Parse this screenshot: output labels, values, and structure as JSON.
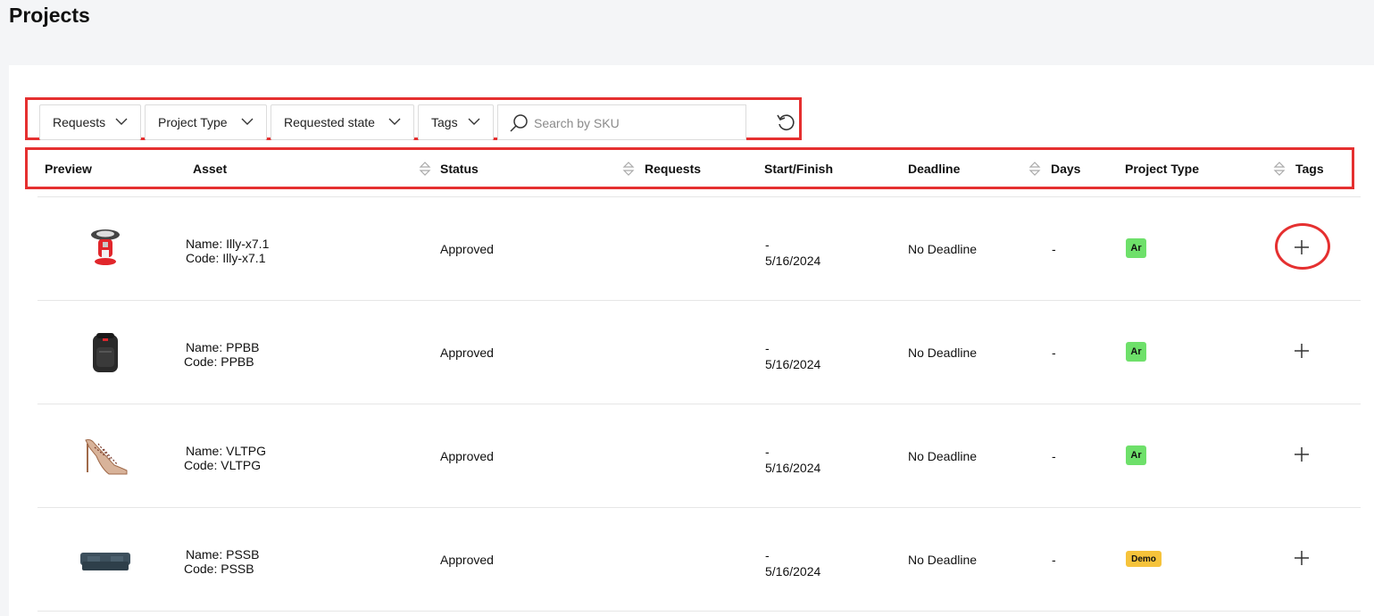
{
  "page": {
    "title": "Projects"
  },
  "filters": {
    "requests": "Requests",
    "project_type": "Project Type",
    "requested_state": "Requested state",
    "tags": "Tags",
    "search_placeholder": "Search by SKU"
  },
  "columns": {
    "preview": "Preview",
    "asset": "Asset",
    "status": "Status",
    "requests": "Requests",
    "start_finish": "Start/Finish",
    "deadline": "Deadline",
    "days": "Days",
    "project_type": "Project Type",
    "tags": "Tags"
  },
  "rows": [
    {
      "name": "Name: Illy-x7.1",
      "code": "Code: Illy-x7.1",
      "status": "Approved",
      "start": "-",
      "finish": "5/16/2024",
      "deadline": "No Deadline",
      "days": "-",
      "project_type": "Ar",
      "preview_icon": "espresso-machine"
    },
    {
      "name": "Name: PPBB",
      "code": "Code: PPBB",
      "status": "Approved",
      "start": "-",
      "finish": "5/16/2024",
      "deadline": "No Deadline",
      "days": "-",
      "project_type": "Ar",
      "preview_icon": "backpack"
    },
    {
      "name": "Name: VLTPG",
      "code": "Code: VLTPG",
      "status": "Approved",
      "start": "-",
      "finish": "5/16/2024",
      "deadline": "No Deadline",
      "days": "-",
      "project_type": "Ar",
      "preview_icon": "high-heel-shoe"
    },
    {
      "name": "Name: PSSB",
      "code": "Code: PSSB",
      "status": "Approved",
      "start": "-",
      "finish": "5/16/2024",
      "deadline": "No Deadline",
      "days": "-",
      "project_type": "Demo",
      "preview_icon": "sofa"
    }
  ],
  "colors": {
    "highlight": "#e53030",
    "badge_ar": "#6ee06a",
    "badge_demo": "#f6c33b"
  }
}
